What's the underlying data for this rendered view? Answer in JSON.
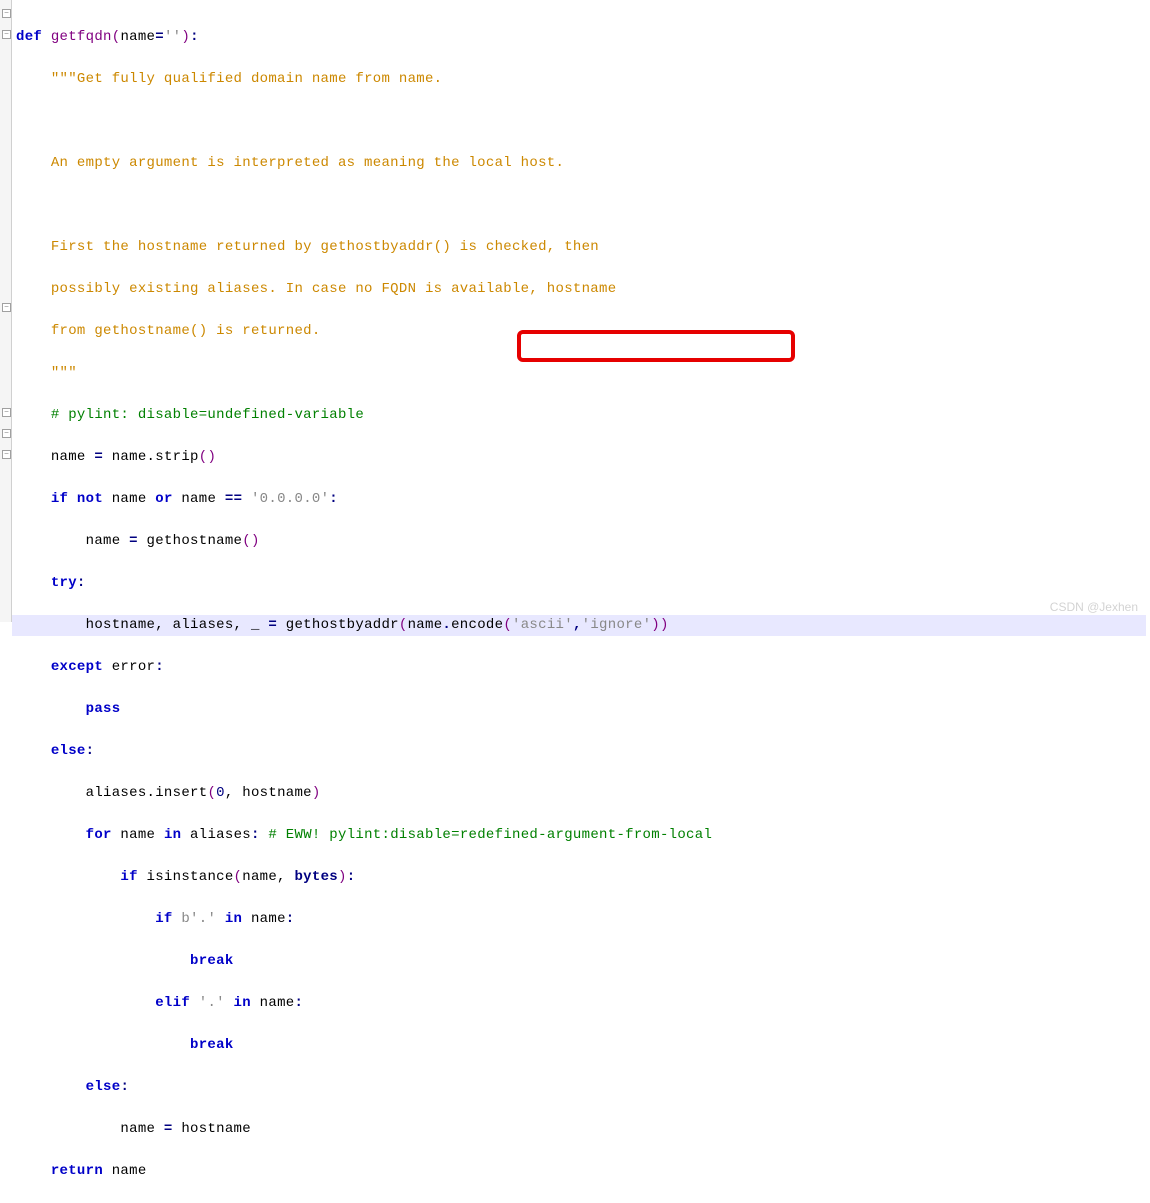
{
  "code": {
    "l1": {
      "def": "def",
      "name": "getfqdn",
      "op": "(",
      "arg": "name",
      "eq": "=",
      "lit": "''",
      "cp": ")",
      "colon": ":"
    },
    "doc_open": "\"\"\"",
    "doc1": "Get fully qualified domain name from name.",
    "doc2": "An empty argument is interpreted as meaning the local host.",
    "doc3": "First the hostname returned by gethostbyaddr() is checked, then",
    "doc4": "possibly existing aliases. In case no FQDN is available, hostname",
    "doc5": "from gethostname() is returned.",
    "doc_close": "\"\"\"",
    "cmt_pylint": "# pylint: disable=undefined-variable",
    "strip_line": {
      "name": "name",
      "eq": " = ",
      "rhs": "name.strip",
      "op": "()"
    },
    "if1": {
      "if": "if",
      "not": " not ",
      "a": "name",
      "or": " or ",
      "b": "name",
      "eq": " == ",
      "lit": "'0.0.0.0'",
      "colon": ":"
    },
    "ghn": {
      "name": "name",
      "eq": " = ",
      "call": "gethostname",
      "op": "()"
    },
    "try": {
      "kw": "try",
      "colon": ":"
    },
    "hba": {
      "lhs": "hostname, aliases, _",
      "eq": " = ",
      "call": "gethostbyaddr",
      "op1": "(",
      "arg": "name",
      "dot": ".",
      "enc": "encode",
      "op2": "(",
      "s1": "'ascii'",
      "comma": ",",
      "s2": "'ignore'",
      "op3": "))"
    },
    "except": {
      "kw": "except",
      "err": " error",
      "colon": ":"
    },
    "pass": "pass",
    "else1": {
      "kw": "else",
      "colon": ":"
    },
    "insert": {
      "a": "aliases.insert",
      "op": "(",
      "num": "0",
      "c": ", hostname",
      "cp": ")"
    },
    "for": {
      "kw": "for",
      "a": " name ",
      "in": "in",
      "b": " aliases",
      "colon": ":",
      "cmt": " # EWW! pylint:disable=redefined-argument-from-local"
    },
    "isinst": {
      "if": "if",
      "call": " isinstance",
      "op": "(",
      "a": "name, ",
      "b": "bytes",
      "cp": ")",
      "colon": ":"
    },
    "ifb": {
      "if": "if",
      "lit": " b'.'",
      "in": " in ",
      "a": "name",
      "colon": ":"
    },
    "break1": "break",
    "elif": {
      "kw": "elif",
      "lit": " '.'",
      "in": " in ",
      "a": "name",
      "colon": ":"
    },
    "break2": "break",
    "else2": {
      "kw": "else",
      "colon": ":"
    },
    "assign": {
      "a": "name",
      "eq": " = ",
      "b": "hostname"
    },
    "ret": {
      "kw": "return",
      "a": " name"
    }
  },
  "watermark": "CSDN @Jexhen"
}
